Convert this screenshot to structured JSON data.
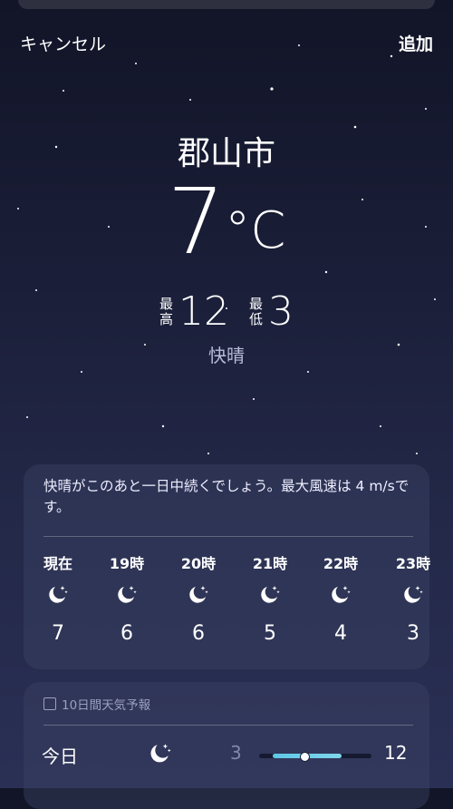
{
  "nav": {
    "cancel": "キャンセル",
    "add": "追加"
  },
  "current": {
    "city": "郡山市",
    "temp": "7",
    "unit": "°C",
    "high_label_1": "最",
    "high_label_2": "高",
    "high": "12",
    "low_label_1": "最",
    "low_label_2": "低",
    "low": "3",
    "condition": "快晴"
  },
  "hourly": {
    "summary": "快晴がこのあと一日中続くでしょう。最大風速は 4 m/sです。",
    "items": [
      {
        "label": "現在",
        "icon": "moon-stars-icon",
        "temp": "7"
      },
      {
        "label": "19時",
        "icon": "moon-stars-icon",
        "temp": "6"
      },
      {
        "label": "20時",
        "icon": "moon-stars-icon",
        "temp": "6"
      },
      {
        "label": "21時",
        "icon": "moon-stars-icon",
        "temp": "5"
      },
      {
        "label": "22時",
        "icon": "moon-stars-icon",
        "temp": "4"
      },
      {
        "label": "23時",
        "icon": "moon-stars-icon",
        "temp": "3"
      }
    ]
  },
  "forecast": {
    "header": "10日間天気予報",
    "header_icon": "calendar-icon",
    "days": [
      {
        "day": "今日",
        "icon": "moon-stars-icon",
        "low": "3",
        "high": "12",
        "current_position": 0.38
      }
    ]
  },
  "colors": {
    "accent_bar": "#5ec8e8",
    "secondary_text": "#b8bcd8"
  }
}
